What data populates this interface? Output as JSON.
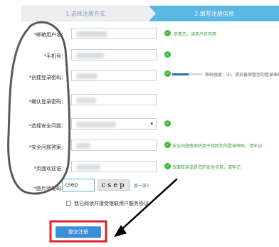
{
  "steps": [
    {
      "label": "1.选择注册方式"
    },
    {
      "label": "2.填写注册信息"
    }
  ],
  "form": {
    "fields": [
      {
        "label": "*邮箱用户名：",
        "hint": "恭喜您，该用户名可用"
      },
      {
        "label": "*手机号：",
        "hint": ""
      },
      {
        "label": "*创建登录密码：",
        "hint": "密码强度：中，请妥善保管您的登录密码"
      },
      {
        "label": "*确认登录密码：",
        "hint": ""
      },
      {
        "label": "*选择安全问题：",
        "hint": ""
      },
      {
        "label": "*安全问题答案：",
        "hint": "安全问题答案将用于找回您的登录密码，请牢记"
      },
      {
        "label": "*页面欢迎语：",
        "hint": "页面欢迎语是您的安全信息，请牢记"
      },
      {
        "label": "*图片验证码：",
        "hint": ""
      }
    ],
    "password_strength": 0.55,
    "select_caret": "▾",
    "captcha": {
      "input_value": "csep",
      "image_text": "csep",
      "refresh_label": "换一张?"
    },
    "agreement_label": "我已阅读并接受银联用户服务协议",
    "submit_label": "提交注册"
  },
  "icons": {
    "ok": "check-circle-icon"
  },
  "colors": {
    "accent": "#5bb7e3",
    "ok": "#42b93a",
    "button": "#3a8fd6",
    "annotation": "#e0202a"
  }
}
